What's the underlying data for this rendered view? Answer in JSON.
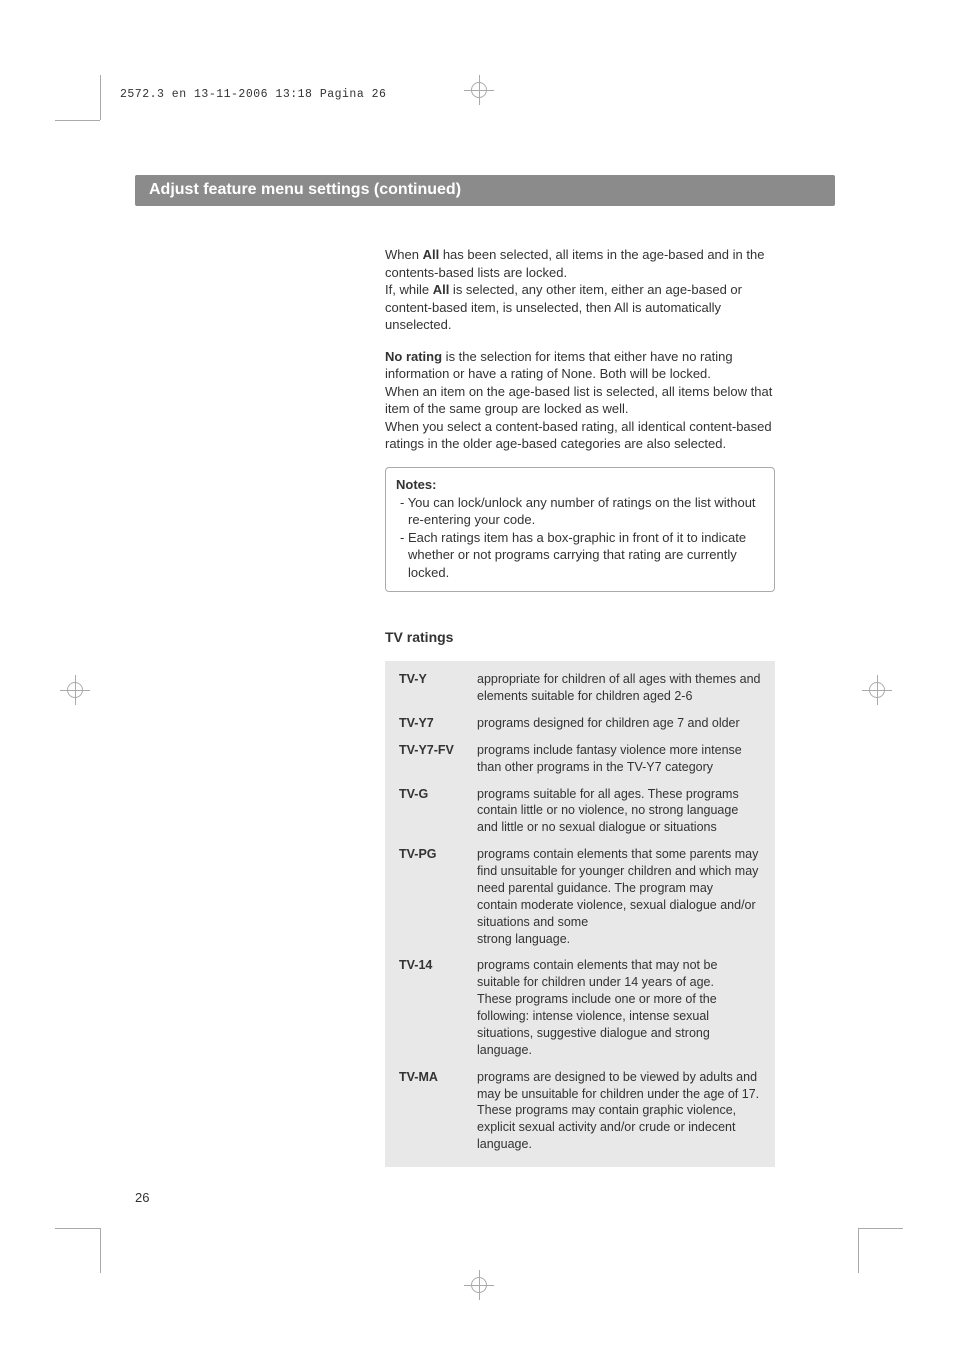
{
  "header_line": "2572.3 en  13-11-2006  13:18  Pagina 26",
  "title_bar": "Adjust feature menu settings  (continued)",
  "page_number": "26",
  "para1_a": "When ",
  "para1_b": "All",
  "para1_c": " has been selected, all items in the age-based and in the contents-based lists are locked.",
  "para2_a": "If, while ",
  "para2_b": "All",
  "para2_c": " is selected, any other item, either an age-based or content-based item, is unselected, then All is automatically unselected.",
  "para3_a": "No rating",
  "para3_b": " is the selection for items that either have no rating information or have a rating of None. Both will be locked.",
  "para4": "When an item on the age-based list is selected, all items below that item of the same group are locked as well.",
  "para5": "When you select a content-based rating, all identical content-based ratings in the older age-based categories are also selected.",
  "notes_title": "Notes:",
  "notes": {
    "0": "- You can lock/unlock any number of ratings on the list without re-entering your code.",
    "1": "- Each ratings item has a box-graphic in front of it to indicate whether or not programs carrying that rating are currently locked."
  },
  "section_title": "TV ratings",
  "ratings": {
    "0": {
      "code": "TV-Y",
      "desc": "appropriate for children of all ages with themes and elements suitable for children aged 2-6"
    },
    "1": {
      "code": "TV-Y7",
      "desc": "programs designed for children age 7 and older"
    },
    "2": {
      "code": "TV-Y7-FV",
      "desc": "programs include fantasy violence more intense than other programs in the TV-Y7 category"
    },
    "3": {
      "code": "TV-G",
      "desc": "programs suitable for all ages. These programs contain little or no violence, no strong language and little or no sexual dialogue or situations"
    },
    "4": {
      "code": "TV-PG",
      "desc": "programs contain elements that some parents may find unsuitable for younger children and which may need parental guidance. The program may",
      "desc2": "contain moderate violence, sexual dialogue and/or situations and some",
      "desc3": "strong language."
    },
    "5": {
      "code": "TV-14",
      "desc": "programs contain elements that may not be suitable for children under 14 years of age.",
      "desc2": "These programs include one or more of the following: intense violence, intense sexual situations, suggestive dialogue and strong language."
    },
    "6": {
      "code": "TV-MA",
      "desc": "programs are designed to be viewed by adults and may be unsuitable for children under the age of 17. These programs may contain graphic violence, explicit sexual activity and/or crude or indecent language."
    }
  }
}
